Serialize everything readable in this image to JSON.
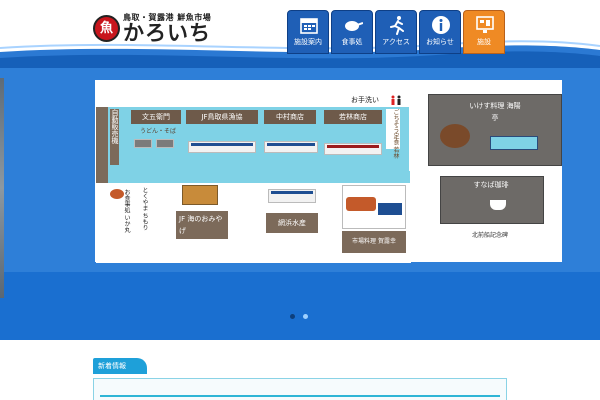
{
  "header": {
    "logo_sub": "鳥取・賀露港 鮮魚市場",
    "logo_main": "かろいち",
    "logo_mark": "魚"
  },
  "nav": {
    "items": [
      {
        "label": "施設案内",
        "icon": "calendar-icon"
      },
      {
        "label": "食事処",
        "icon": "frying-pan-icon"
      },
      {
        "label": "アクセス",
        "icon": "running-person-icon"
      },
      {
        "label": "お知らせ",
        "icon": "info-icon"
      },
      {
        "label": "施設",
        "icon": "floor-map-icon",
        "active": true
      }
    ]
  },
  "map": {
    "toilet": "お手洗い",
    "vending": "自動販売機",
    "shops": {
      "bunko": "文五衛門",
      "bunko_sub": "うどん・そば",
      "jf_tottori": "JF鳥取県漁協",
      "nakamura": "中村商店",
      "wakabayashi": "若林商店",
      "wakabayashi_side": "ごちそう定食 若林",
      "kaiyo_label": "お食事処 いか丸",
      "tokuyama": "とくやま ちもり",
      "jf_umi": "JF 海のおみやげ",
      "amihama": "網浜水産",
      "karo": "市場料理 賀露幸",
      "kaiyotei": "いけす料理 海陽亭",
      "sunaba": "すなば珈琲",
      "kitamae": "北前船記念碑"
    }
  },
  "carousel": {
    "dots": [
      false,
      true
    ]
  },
  "info": {
    "tab_label": "新着情報"
  },
  "colors": {
    "nav_blue": "#1f5fb6",
    "nav_active": "#ef8a24",
    "hero_blue": "#2e7fd8",
    "map_aqua": "#7fd2e6",
    "logo_red": "#c8161d"
  }
}
